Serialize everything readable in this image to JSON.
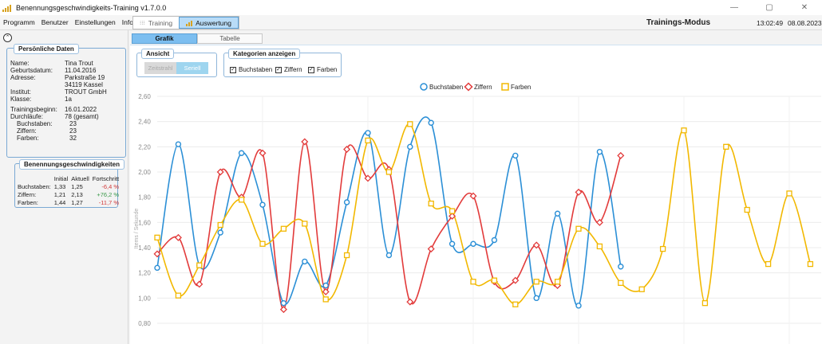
{
  "window": {
    "title": "Benennungsgeschwindigkeits-Training v1.7.0.0",
    "controls": [
      "—",
      "▢",
      "✕"
    ]
  },
  "menu": [
    "Programm",
    "Benutzer",
    "Einstellungen",
    "Info"
  ],
  "mode_tabs": [
    {
      "label": "Training",
      "icon": "grid-icon",
      "active": false
    },
    {
      "label": "Auswertung",
      "icon": "chart-icon",
      "active": true
    }
  ],
  "header": {
    "mode": "Trainings-Modus",
    "time": "13:02:49",
    "date": "08.08.2023"
  },
  "personal": {
    "title": "Persönliche Daten",
    "name_label": "Name:",
    "name": "Tina Trout",
    "birth_label": "Geburtsdatum:",
    "birth": "11.04.2016",
    "address_label": "Adresse:",
    "address_street": "Parkstraße 19",
    "address_city": "34119 Kassel",
    "institute_label": "Institut:",
    "institute": "TROUT GmbH",
    "class_label": "Klasse:",
    "class": "1a",
    "start_label": "Trainingsbeginn:",
    "start": "16.01.2022",
    "runs_label": "Durchläufe:",
    "runs": "78 (gesamt)",
    "letters_label": "Buchstaben:",
    "letters": "23",
    "digits_label": "Ziffern:",
    "digits": "23",
    "colors_label": "Farben:",
    "colors": "32"
  },
  "speeds": {
    "title": "Benennungsgeschwindigkeiten",
    "headers": [
      "Initial",
      "Aktuell",
      "Fortschritt"
    ],
    "rows": [
      {
        "label": "Buchstaben:",
        "initial": "1,33",
        "current": "1,25",
        "progress": "-6,4 %",
        "trend": "neg"
      },
      {
        "label": "Ziffern:",
        "initial": "1,21",
        "current": "2,13",
        "progress": "+76,2 %",
        "trend": "pos"
      },
      {
        "label": "Farben:",
        "initial": "1,44",
        "current": "1,27",
        "progress": "-11,7 %",
        "trend": "neg"
      }
    ]
  },
  "view_tabs": [
    {
      "label": "Grafik",
      "active": true
    },
    {
      "label": "Tabelle",
      "active": false
    }
  ],
  "ansicht": {
    "title": "Ansicht",
    "options": [
      {
        "label": "Zeitstrahl",
        "active": false
      },
      {
        "label": "Seriell",
        "active": true
      }
    ]
  },
  "kategorien": {
    "title": "Kategorien anzeigen",
    "items": [
      {
        "label": "Buchstaben",
        "checked": true
      },
      {
        "label": "Ziffern",
        "checked": true
      },
      {
        "label": "Farben",
        "checked": true
      }
    ]
  },
  "chart_data": {
    "type": "line",
    "ylabel": "Items / Sekunde",
    "ylim": [
      0.8,
      2.6
    ],
    "yticks": [
      "0,80",
      "1,00",
      "1,20",
      "1,40",
      "1,60",
      "1,80",
      "2,00",
      "2,20",
      "2,40",
      "2,60"
    ],
    "grid": true,
    "legend": "top-center",
    "series": [
      {
        "name": "Buchstaben",
        "color": "#2b8fd6",
        "marker": "circle",
        "values": [
          1.24,
          2.22,
          1.26,
          1.52,
          2.15,
          1.74,
          0.96,
          1.29,
          1.1,
          1.76,
          2.31,
          1.34,
          2.2,
          2.39,
          1.43,
          1.43,
          1.46,
          2.13,
          1.0,
          1.67,
          0.94,
          2.16,
          1.25
        ]
      },
      {
        "name": "Ziffern",
        "color": "#e23b3b",
        "marker": "diamond",
        "values": [
          1.35,
          1.48,
          1.11,
          2.0,
          1.8,
          2.15,
          0.91,
          2.24,
          1.05,
          2.18,
          1.95,
          2.02,
          0.97,
          1.39,
          1.65,
          1.81,
          1.13,
          1.14,
          1.42,
          1.1,
          1.84,
          1.6,
          2.13
        ]
      },
      {
        "name": "Farben",
        "color": "#f2b800",
        "marker": "square",
        "values": [
          1.48,
          1.02,
          1.26,
          1.58,
          1.78,
          1.43,
          1.55,
          1.59,
          0.99,
          1.34,
          2.25,
          2.0,
          2.38,
          1.75,
          1.69,
          1.13,
          1.14,
          0.95,
          1.13,
          1.13,
          1.55,
          1.41,
          1.12,
          1.07,
          1.39,
          2.33,
          0.96,
          2.2,
          1.7,
          1.27,
          1.83,
          1.27
        ]
      }
    ]
  }
}
